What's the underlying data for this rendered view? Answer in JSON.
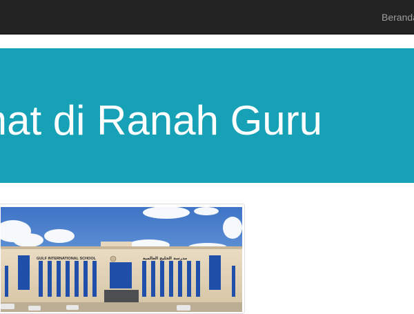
{
  "nav": {
    "items": [
      {
        "label": "Beranda"
      }
    ]
  },
  "hero": {
    "title": "Selamat di Ranah Guru"
  },
  "photo": {
    "sign_en": "GULF INTERNATIONAL SCHOOL",
    "sign_ar": "مدرسة الخليج العالمية"
  },
  "colors": {
    "navbar": "#222222",
    "nav_text": "#9d9d9d",
    "hero_bg": "#16a1b6",
    "hero_text": "#ffffff"
  }
}
